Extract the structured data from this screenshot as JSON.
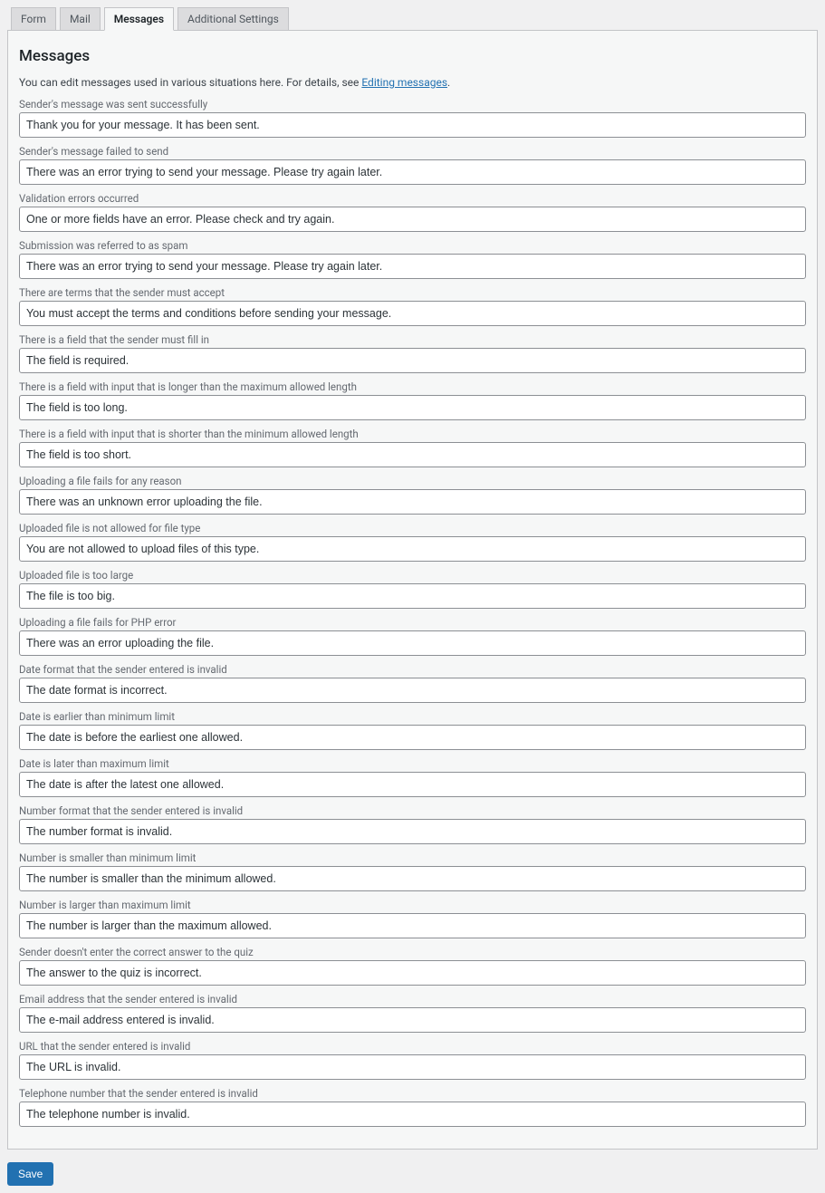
{
  "tabs": {
    "form": "Form",
    "mail": "Mail",
    "messages": "Messages",
    "additional": "Additional Settings"
  },
  "heading": "Messages",
  "intro_pre": "You can edit messages used in various situations here. For details, see ",
  "intro_link": "Editing messages",
  "intro_post": ".",
  "fields": [
    {
      "label": "Sender's message was sent successfully",
      "value": "Thank you for your message. It has been sent."
    },
    {
      "label": "Sender's message failed to send",
      "value": "There was an error trying to send your message. Please try again later."
    },
    {
      "label": "Validation errors occurred",
      "value": "One or more fields have an error. Please check and try again."
    },
    {
      "label": "Submission was referred to as spam",
      "value": "There was an error trying to send your message. Please try again later."
    },
    {
      "label": "There are terms that the sender must accept",
      "value": "You must accept the terms and conditions before sending your message."
    },
    {
      "label": "There is a field that the sender must fill in",
      "value": "The field is required."
    },
    {
      "label": "There is a field with input that is longer than the maximum allowed length",
      "value": "The field is too long."
    },
    {
      "label": "There is a field with input that is shorter than the minimum allowed length",
      "value": "The field is too short."
    },
    {
      "label": "Uploading a file fails for any reason",
      "value": "There was an unknown error uploading the file."
    },
    {
      "label": "Uploaded file is not allowed for file type",
      "value": "You are not allowed to upload files of this type."
    },
    {
      "label": "Uploaded file is too large",
      "value": "The file is too big."
    },
    {
      "label": "Uploading a file fails for PHP error",
      "value": "There was an error uploading the file."
    },
    {
      "label": "Date format that the sender entered is invalid",
      "value": "The date format is incorrect."
    },
    {
      "label": "Date is earlier than minimum limit",
      "value": "The date is before the earliest one allowed."
    },
    {
      "label": "Date is later than maximum limit",
      "value": "The date is after the latest one allowed."
    },
    {
      "label": "Number format that the sender entered is invalid",
      "value": "The number format is invalid."
    },
    {
      "label": "Number is smaller than minimum limit",
      "value": "The number is smaller than the minimum allowed."
    },
    {
      "label": "Number is larger than maximum limit",
      "value": "The number is larger than the maximum allowed."
    },
    {
      "label": "Sender doesn't enter the correct answer to the quiz",
      "value": "The answer to the quiz is incorrect."
    },
    {
      "label": "Email address that the sender entered is invalid",
      "value": "The e-mail address entered is invalid."
    },
    {
      "label": "URL that the sender entered is invalid",
      "value": "The URL is invalid."
    },
    {
      "label": "Telephone number that the sender entered is invalid",
      "value": "The telephone number is invalid."
    }
  ],
  "save_label": "Save"
}
